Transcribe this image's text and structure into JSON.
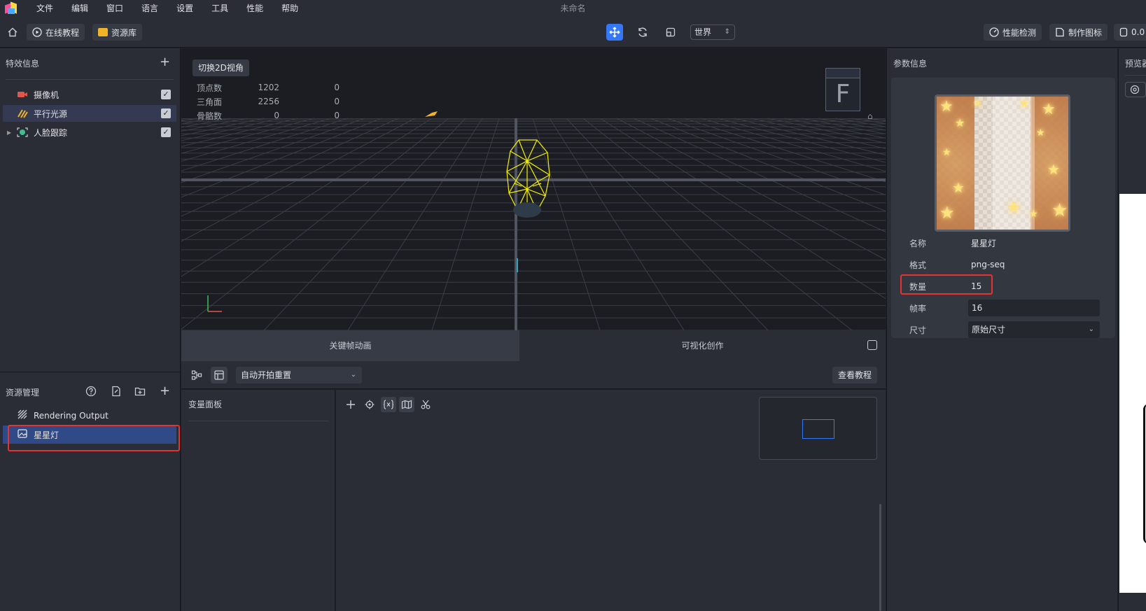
{
  "window": {
    "title": "未命名"
  },
  "menu": [
    "文件",
    "编辑",
    "窗口",
    "语言",
    "设置",
    "工具",
    "性能",
    "帮助"
  ],
  "toolbar": {
    "tutorial_label": "在线教程",
    "library_label": "资源库",
    "space_select": "世界",
    "perf_label": "性能检测",
    "make_icon_label": "制作图标",
    "version_label": "0.0"
  },
  "effects_panel": {
    "title": "特效信息",
    "items": [
      {
        "label": "摄像机",
        "checked": true
      },
      {
        "label": "平行光源",
        "checked": true
      },
      {
        "label": "人脸跟踪",
        "checked": true
      }
    ]
  },
  "resource_panel": {
    "title": "资源管理",
    "items": [
      {
        "label": "Rendering Output"
      },
      {
        "label": "星星灯"
      }
    ]
  },
  "viewport": {
    "switch_label": "切换2D视角",
    "stats": [
      {
        "label": "顶点数",
        "a": "1202",
        "b": "0"
      },
      {
        "label": "三角面",
        "a": "2256",
        "b": "0"
      },
      {
        "label": "骨骼数",
        "a": "0",
        "b": "0"
      }
    ],
    "gizmo_face": "F"
  },
  "tabs": {
    "keyframe": "关键帧动画",
    "visual": "可视化创作"
  },
  "graph_toolbar": {
    "mode_select": "自动开拍重置",
    "tutorial_button": "查看教程"
  },
  "var_panel": {
    "title": "变量面板"
  },
  "params": {
    "title": "参数信息",
    "rows": {
      "name": {
        "label": "名称",
        "value": "星星灯"
      },
      "format": {
        "label": "格式",
        "value": "png-seq"
      },
      "count": {
        "label": "数量",
        "value": "15"
      },
      "fps": {
        "label": "帧率",
        "value": "16"
      },
      "size": {
        "label": "尺寸",
        "value": "原始尺寸"
      }
    }
  },
  "preview": {
    "title": "预览器"
  },
  "colors": {
    "accent": "#3478f6",
    "highlight_box": "#e8322f",
    "wireframe": "#f4f000"
  }
}
